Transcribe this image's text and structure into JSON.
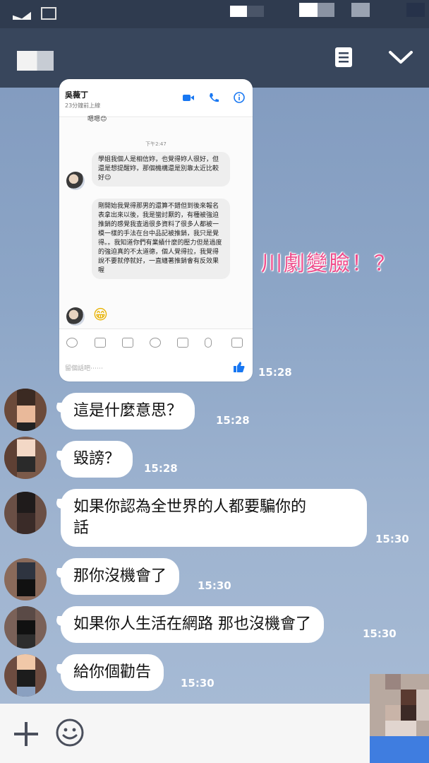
{
  "shared_screenshot": {
    "contact_name": "吳薇丁",
    "last_active": "23分鐘前上線",
    "partial_top_message": "嗯嗯😊",
    "time_divider": "下午2:47",
    "messages": [
      "學姐我個人是相信妳，也覺得妳人很好，但還是想提醒妳，那個機構還是別靠太近比較好😉",
      "剛開始我覺得那男的還算不錯但到後來報名表拿出來以後，我是蠻討厭的，有種被強迫推銷的感覺我查過很多資料了很多人都被一模一樣的手法在台中品記被推銷，我只是覺得。。我知道你們有業績什麼的壓力但是過度的強迫真的不太道德，個人覺得拉，我覺得說不要就停就好，一直纏著推銷會有反效果喔"
    ],
    "emoji_reply": "😁",
    "input_placeholder": "留個話吧⋯⋯",
    "sent_time": "15:28"
  },
  "overlay_caption": "川劇變臉！？",
  "messages": [
    {
      "text": "這是什麼意思？",
      "time": "15:28"
    },
    {
      "text": "毀謗？",
      "time": "15:28"
    },
    {
      "text": "如果你認為全世界的人都要騙你的\n話",
      "time": "15:30"
    },
    {
      "text": "那你沒機會了",
      "time": "15:30"
    },
    {
      "text": "如果你人生活在網路 那也沒機會了",
      "time": "15:30"
    },
    {
      "text": "給你個勸告",
      "time": "15:30"
    }
  ],
  "colors": {
    "topbar": "#38465c",
    "statusbar": "#2f3b4f",
    "chat_bg": "#8da6c7",
    "bubble": "#ffffff",
    "overlay_text": "#ee4d8c"
  },
  "icons": {
    "topbar_left": "note-icon",
    "topbar_right": "chevron-down-icon",
    "bottom_left": "plus-icon",
    "bottom_emoji": "emoji-icon"
  }
}
